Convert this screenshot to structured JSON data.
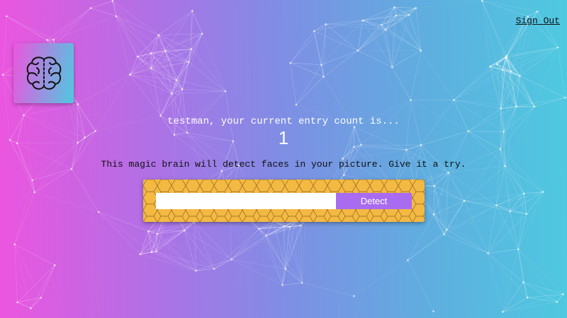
{
  "nav": {
    "signout_label": "Sign Out"
  },
  "logo": {
    "icon": "brain-icon"
  },
  "rank": {
    "message": "testman, your current entry count is...",
    "count": "1"
  },
  "tagline": "This magic brain will detect faces in your picture. Give it a try.",
  "form": {
    "input_value": "",
    "detect_label": "Detect"
  },
  "colors": {
    "gradient_start": "#ec55df",
    "gradient_end": "#4ec9e0",
    "panel": "#f4b942",
    "button": "#a96cf0"
  }
}
